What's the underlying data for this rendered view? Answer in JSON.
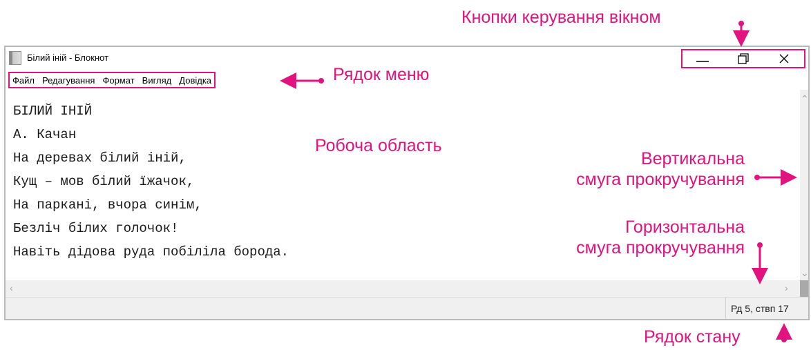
{
  "window": {
    "title": "Білий іній - Блокнот",
    "menu": [
      "Файл",
      "Редагування",
      "Формат",
      "Вигляд",
      "Довідка"
    ]
  },
  "controls_icons": [
    "minimize-icon",
    "restore-icon",
    "close-icon"
  ],
  "document": {
    "lines": [
      "БІЛИЙ ІНІЙ",
      "А. Качан",
      "На деревах білий іній,",
      "Кущ – мов білий їжачок,",
      "На паркані, вчора синім,",
      "Безліч білих голочок!",
      "Навіть дідова руда побіліла борода."
    ]
  },
  "status": {
    "position": "Рд 5, ствп 17"
  },
  "callouts": {
    "window_buttons": "Кнопки керування вікном",
    "menu_bar": "Рядок меню",
    "work_area": "Робоча область",
    "vertical_scroll": [
      "Вертикальна",
      "смуга прокручування"
    ],
    "horizontal_scroll": [
      "Горизонтальна",
      "смуга прокручування"
    ],
    "status_bar": "Рядок стану"
  },
  "colors": {
    "accent": "#e0137f",
    "frame": "#b9b9b9",
    "bar": "#f0f0f0"
  }
}
